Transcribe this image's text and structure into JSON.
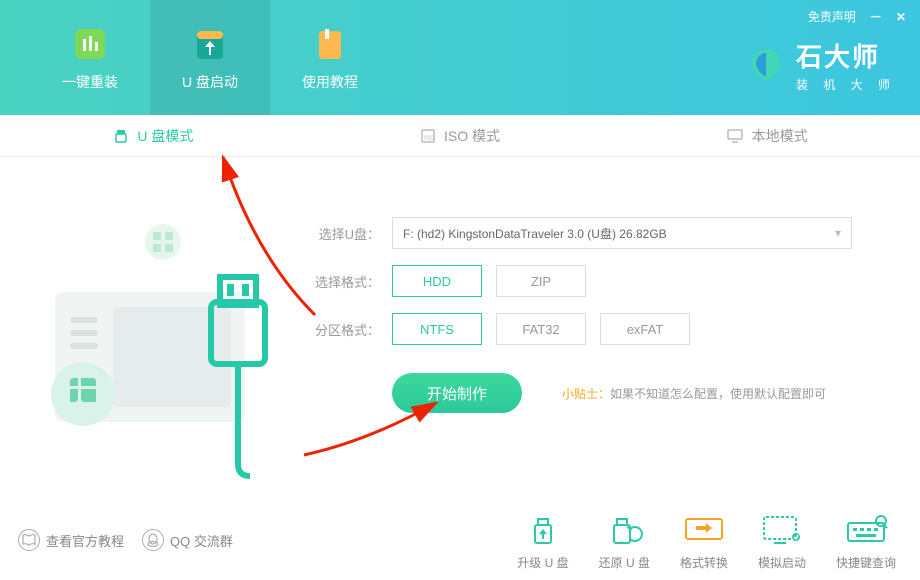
{
  "header": {
    "disclaimer": "免责声明",
    "nav": [
      {
        "label": "一键重装"
      },
      {
        "label": "U 盘启动"
      },
      {
        "label": "使用教程"
      }
    ],
    "logo": {
      "title": "石大师",
      "subtitle": "装 机 大 师"
    }
  },
  "modes": [
    {
      "label": "U 盘模式",
      "active": true
    },
    {
      "label": "ISO 模式",
      "active": false
    },
    {
      "label": "本地模式",
      "active": false
    }
  ],
  "form": {
    "disk_label": "选择U盘：",
    "disk_value": "F: (hd2) KingstonDataTraveler 3.0 (U盘) 26.82GB",
    "format_label": "选择格式：",
    "format_options": [
      "HDD",
      "ZIP"
    ],
    "partition_label": "分区格式：",
    "partition_options": [
      "NTFS",
      "FAT32",
      "exFAT"
    ]
  },
  "action": {
    "primary": "开始制作",
    "tip_label": "小贴士：",
    "tip_text": "如果不知道怎么配置，使用默认配置即可"
  },
  "footer": {
    "links": [
      {
        "label": "查看官方教程"
      },
      {
        "label": "QQ 交流群"
      }
    ],
    "tools": [
      {
        "label": "升级 U 盘"
      },
      {
        "label": "还原 U 盘"
      },
      {
        "label": "格式转换"
      },
      {
        "label": "模拟启动"
      },
      {
        "label": "快捷键查询"
      }
    ]
  }
}
